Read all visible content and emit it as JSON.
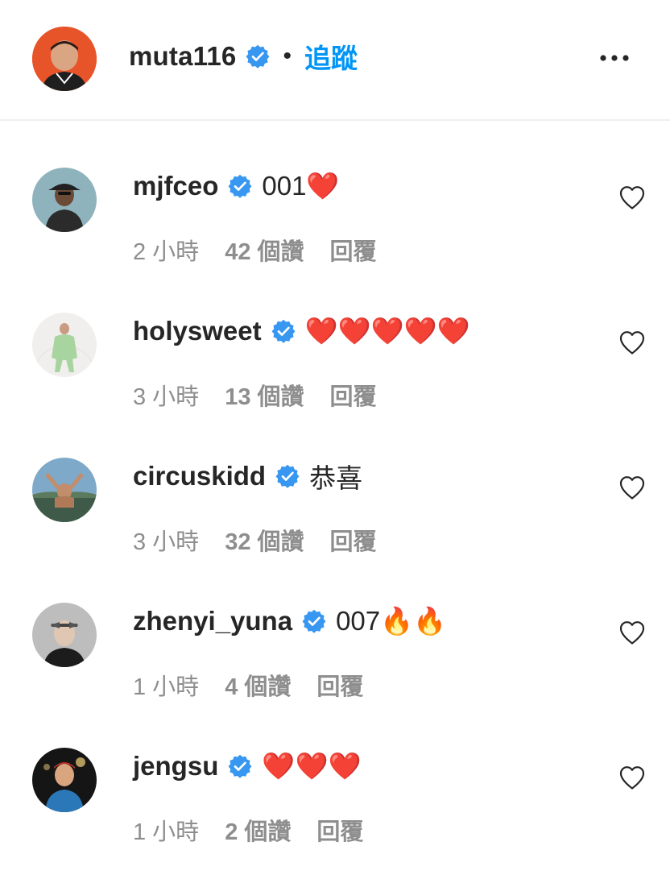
{
  "header": {
    "username": "muta116",
    "separator": "•",
    "follow_label": "追蹤",
    "more_icon": "more-horizontal-icon"
  },
  "colors": {
    "accent": "#0095f6",
    "verified": "#3897f0",
    "meta_text": "#8e8e8e",
    "heart_emoji": "#e0245e"
  },
  "comments": [
    {
      "username": "mjfceo",
      "text": "001❤️",
      "time": "2 小時",
      "likes": "42 個讚",
      "reply": "回覆"
    },
    {
      "username": "holysweet",
      "text": "❤️❤️❤️❤️❤️",
      "time": "3 小時",
      "likes": "13 個讚",
      "reply": "回覆"
    },
    {
      "username": "circuskidd",
      "text": "恭喜",
      "time": "3 小時",
      "likes": "32 個讚",
      "reply": "回覆"
    },
    {
      "username": "zhenyi_yuna",
      "text": "007🔥🔥",
      "time": "1 小時",
      "likes": "4 個讚",
      "reply": "回覆"
    },
    {
      "username": "jengsu",
      "text": "❤️❤️❤️",
      "time": "1 小時",
      "likes": "2 個讚",
      "reply": "回覆"
    }
  ]
}
